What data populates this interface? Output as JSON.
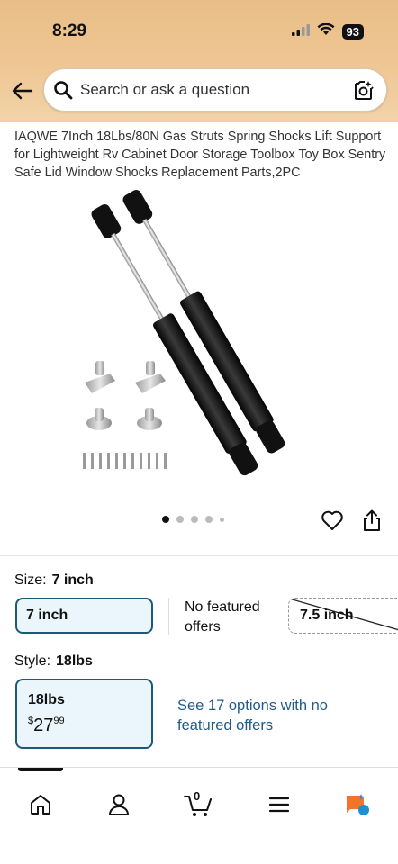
{
  "status": {
    "time": "8:29",
    "battery": "93"
  },
  "search": {
    "placeholder": "Search or ask a question"
  },
  "product": {
    "title": "IAQWE 7Inch 18Lbs/80N Gas Struts Spring Shocks Lift Support for Lightweight Rv Cabinet Door Storage Toolbox Toy Box Sentry Safe Lid Window Shocks Replacement Parts,2PC",
    "image_count": 5,
    "active_image": 1
  },
  "size": {
    "label": "Size:",
    "selected": "7 inch",
    "options": [
      {
        "label": "7 inch",
        "selected": true
      },
      {
        "label": "7.5 inch",
        "available": false
      }
    ],
    "no_featured": "No featured offers"
  },
  "style": {
    "label": "Style:",
    "selected": "18lbs",
    "option": {
      "label": "18lbs",
      "currency": "$",
      "price_whole": "27",
      "price_fraction": "99"
    },
    "see_options": "See 17 options with no featured offers"
  },
  "nav": {
    "items": [
      "home-icon",
      "account-icon",
      "cart-icon",
      "menu-icon",
      "rufus-icon"
    ],
    "cart_count": "0"
  },
  "colors": {
    "accent": "#1b5a76",
    "link": "#1f5c8a",
    "header": "#efc896"
  }
}
